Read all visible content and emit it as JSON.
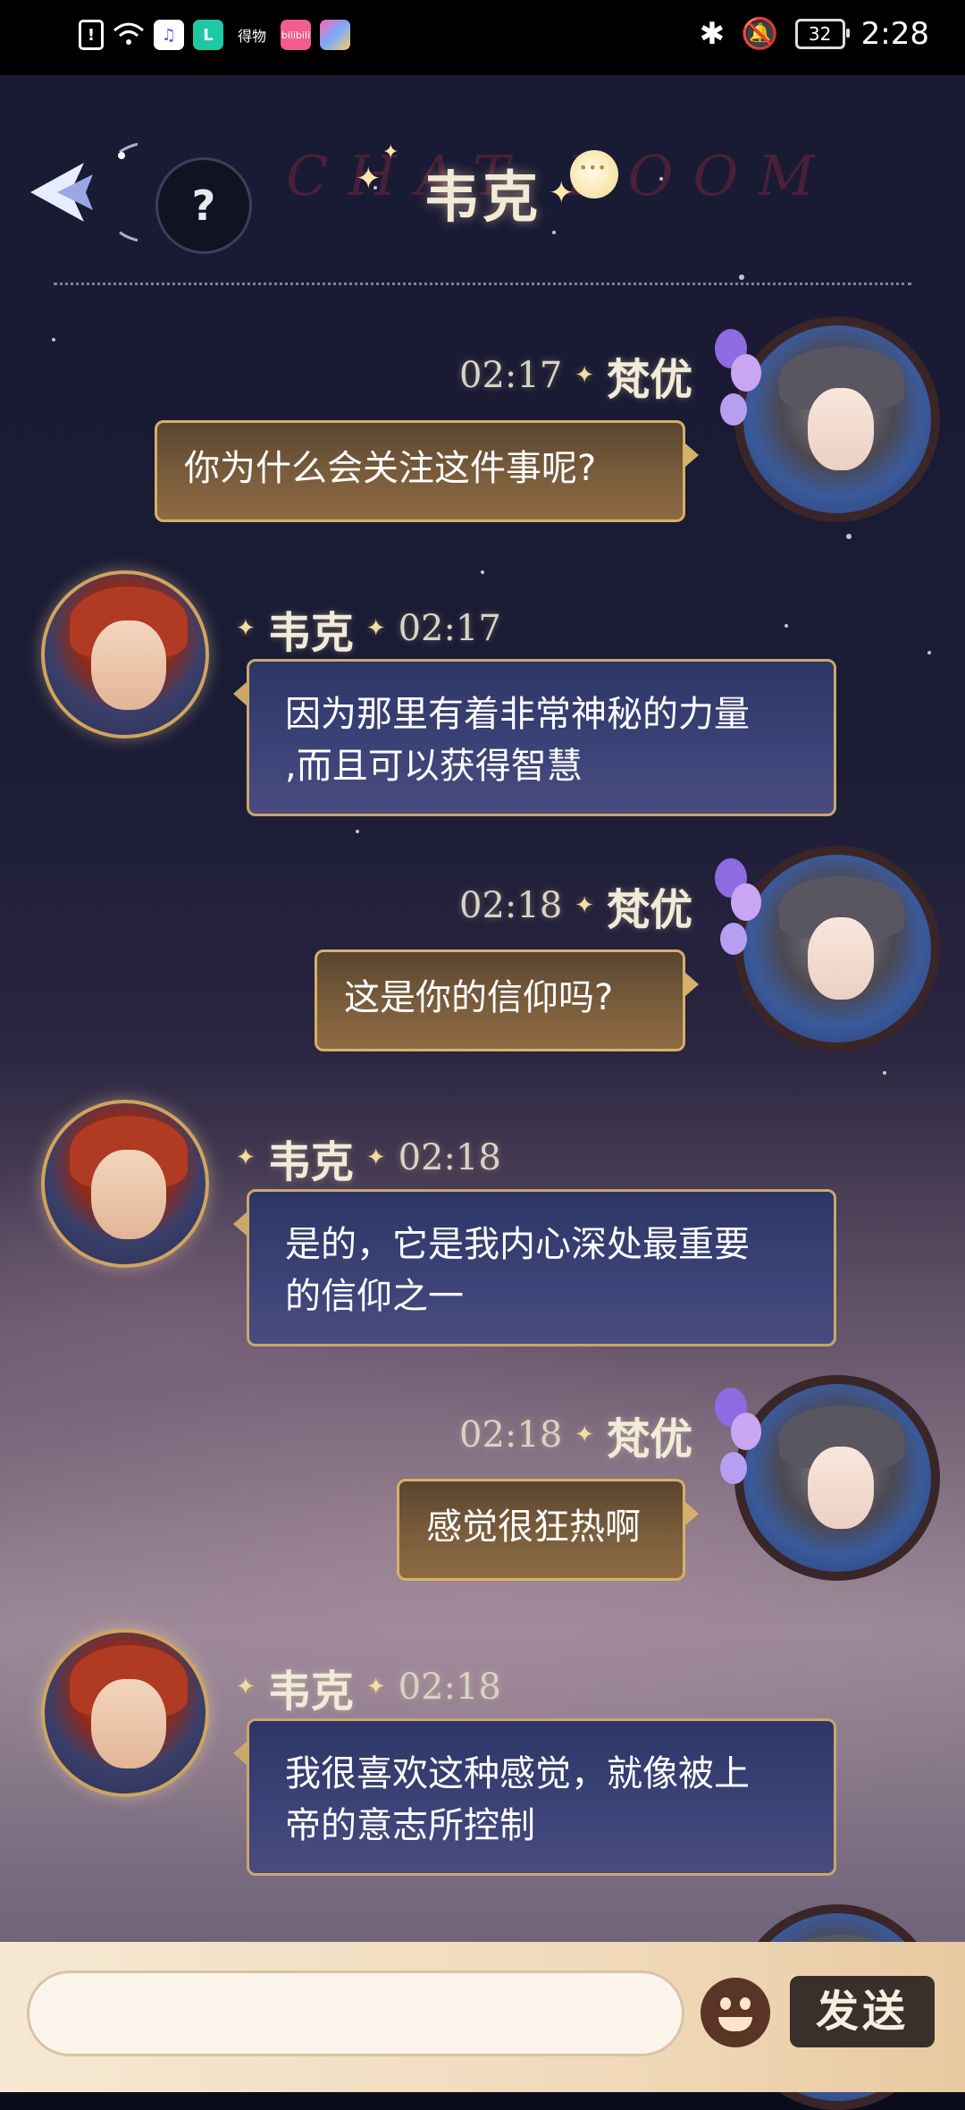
{
  "status_bar": {
    "time": "2:28",
    "battery": "32",
    "left_icons": [
      "alert-icon",
      "wifi-icon",
      "music-app-icon",
      "l-app-icon",
      "dewu-app-icon",
      "bilibili-app-icon",
      "flower-app-icon"
    ],
    "dewu_label": "得物",
    "bili_label": "bilibili"
  },
  "header": {
    "help_label": "?",
    "title": "韦克",
    "watermark": "CHAT ROOM"
  },
  "messages": [
    {
      "side": "right",
      "name": "梵优",
      "time": "02:17",
      "text_lines": [
        "你为什么会关注这件事呢?"
      ]
    },
    {
      "side": "left",
      "name": "韦克",
      "time": "02:17",
      "text_lines": [
        "因为那里有着非常神秘的力量",
        ",而且可以获得智慧"
      ]
    },
    {
      "side": "right",
      "name": "梵优",
      "time": "02:18",
      "text_lines": [
        "这是你的信仰吗?"
      ]
    },
    {
      "side": "left",
      "name": "韦克",
      "time": "02:18",
      "text_lines": [
        "是的，它是我内心深处最重要",
        "的信仰之一"
      ]
    },
    {
      "side": "right",
      "name": "梵优",
      "time": "02:18",
      "text_lines": [
        "感觉很狂热啊"
      ]
    },
    {
      "side": "left",
      "name": "韦克",
      "time": "02:18",
      "text_lines": [
        "我很喜欢这种感觉，就像被上",
        "帝的意志所控制"
      ]
    }
  ],
  "input": {
    "value": "",
    "placeholder": ""
  },
  "send_label": "发送",
  "colors": {
    "accent_gold": "#d6b06a",
    "left_bubble": "#3c4378",
    "right_bubble": "#7a5d3c",
    "send_button": "#3a2f2a"
  }
}
